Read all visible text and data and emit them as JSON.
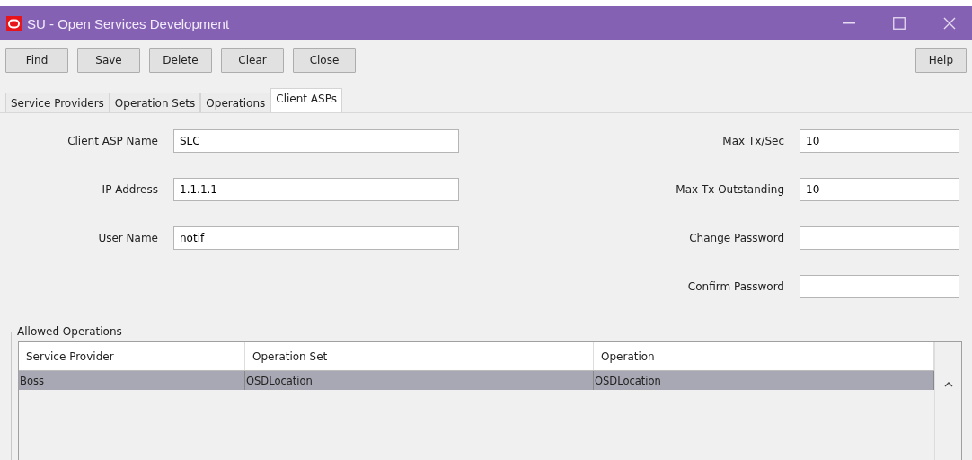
{
  "window": {
    "title": "SU - Open Services Development"
  },
  "toolbar": {
    "buttons": [
      "Find",
      "Save",
      "Delete",
      "Clear",
      "Close"
    ],
    "help": "Help"
  },
  "tabs": [
    {
      "label": "Service Providers",
      "selected": false
    },
    {
      "label": "Operation Sets",
      "selected": false
    },
    {
      "label": "Operations",
      "selected": false
    },
    {
      "label": "Client ASPs",
      "selected": true
    }
  ],
  "left_fields": [
    {
      "label": "Client ASP Name",
      "value": "SLC"
    },
    {
      "label": "IP Address",
      "value": "1.1.1.1"
    },
    {
      "label": "User Name",
      "value": "notif"
    }
  ],
  "right_fields": [
    {
      "label": "Max Tx/Sec",
      "value": "10"
    },
    {
      "label": "Max Tx Outstanding",
      "value": "10"
    },
    {
      "label": "Change Password"
    },
    {
      "label": "Confirm Password"
    }
  ],
  "allowed_operations": {
    "title": "Allowed Operations",
    "columns": [
      "Service Provider",
      "Operation Set",
      "Operation"
    ],
    "rows": [
      {
        "cells": [
          "Boss",
          "OSDLocation",
          "OSDLocation"
        ],
        "selected": true
      }
    ]
  }
}
